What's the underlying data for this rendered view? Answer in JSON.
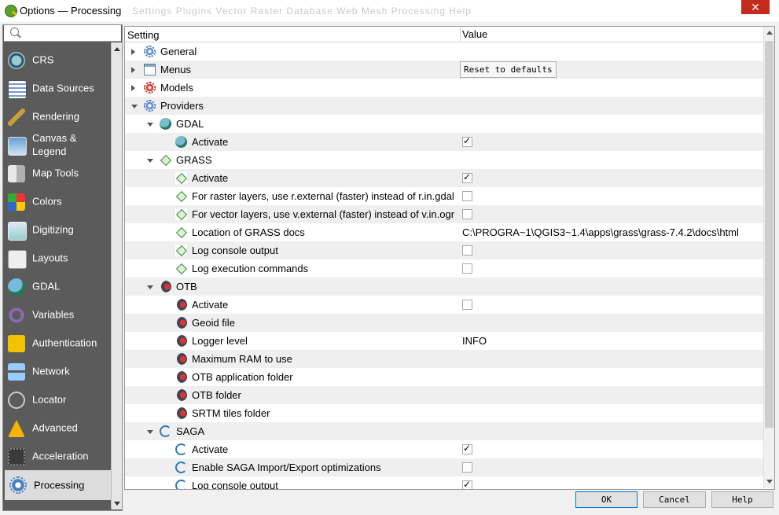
{
  "window": {
    "title": "Options — Processing",
    "background_menu": "Settings   Plugins   Vector   Raster   Database   Web   Mesh   Processing   Help",
    "close_label": "✕"
  },
  "sidebar": {
    "search_placeholder": "",
    "items": [
      {
        "label": "CRS",
        "icon": "globe-grid-icon"
      },
      {
        "label": "Data Sources",
        "icon": "table-icon"
      },
      {
        "label": "Rendering",
        "icon": "paintbrush-icon"
      },
      {
        "label": "Canvas &\nLegend",
        "icon": "map-canvas-icon"
      },
      {
        "label": "Map Tools",
        "icon": "map-tools-icon"
      },
      {
        "label": "Colors",
        "icon": "color-grid-icon"
      },
      {
        "label": "Digitizing",
        "icon": "digitizing-icon"
      },
      {
        "label": "Layouts",
        "icon": "layout-icon"
      },
      {
        "label": "GDAL",
        "icon": "gdal-globe-icon"
      },
      {
        "label": "Variables",
        "icon": "variables-icon"
      },
      {
        "label": "Authentication",
        "icon": "padlock-icon"
      },
      {
        "label": "Network",
        "icon": "network-icon"
      },
      {
        "label": "Locator",
        "icon": "magnifier-icon"
      },
      {
        "label": "Advanced",
        "icon": "warning-icon"
      },
      {
        "label": "Acceleration",
        "icon": "chip-icon"
      },
      {
        "label": "Processing",
        "icon": "gear-icon",
        "selected": true
      }
    ]
  },
  "tree": {
    "columns": [
      "Setting",
      "Value"
    ],
    "reset_label": "Reset to defaults",
    "rows": [
      {
        "label": "General",
        "level": 0,
        "expand": "closed",
        "icon": "gear"
      },
      {
        "label": "Menus",
        "level": 0,
        "expand": "closed",
        "icon": "menu",
        "button": true
      },
      {
        "label": "Models",
        "level": 0,
        "expand": "closed",
        "icon": "gear-red"
      },
      {
        "label": "Providers",
        "level": 0,
        "expand": "open",
        "icon": "gear"
      },
      {
        "label": "GDAL",
        "level": 1,
        "expand": "open",
        "icon": "gdal"
      },
      {
        "label": "Activate",
        "level": 2,
        "icon": "gdal",
        "check": true
      },
      {
        "label": "GRASS",
        "level": 1,
        "expand": "open",
        "icon": "grass"
      },
      {
        "label": "Activate",
        "level": 2,
        "icon": "grass",
        "check": true
      },
      {
        "label": "For raster layers, use r.external (faster) instead of r.in.gdal",
        "level": 2,
        "icon": "grass",
        "check": false
      },
      {
        "label": "For vector layers, use v.external (faster) instead of v.in.ogr",
        "level": 2,
        "icon": "grass",
        "check": false
      },
      {
        "label": "Location of GRASS docs",
        "level": 2,
        "icon": "grass",
        "value": "C:\\PROGRA~1\\QGIS3~1.4\\apps\\grass\\grass-7.4.2\\docs\\html"
      },
      {
        "label": "Log console output",
        "level": 2,
        "icon": "grass",
        "check": false
      },
      {
        "label": "Log execution commands",
        "level": 2,
        "icon": "grass",
        "check": false
      },
      {
        "label": "OTB",
        "level": 1,
        "expand": "open",
        "icon": "otb"
      },
      {
        "label": "Activate",
        "level": 2,
        "icon": "otb",
        "check": false
      },
      {
        "label": "Geoid file",
        "level": 2,
        "icon": "otb"
      },
      {
        "label": "Logger level",
        "level": 2,
        "icon": "otb",
        "value": "INFO"
      },
      {
        "label": "Maximum RAM to use",
        "level": 2,
        "icon": "otb"
      },
      {
        "label": "OTB application folder",
        "level": 2,
        "icon": "otb"
      },
      {
        "label": "OTB folder",
        "level": 2,
        "icon": "otb"
      },
      {
        "label": "SRTM tiles folder",
        "level": 2,
        "icon": "otb"
      },
      {
        "label": "SAGA",
        "level": 1,
        "expand": "open",
        "icon": "saga"
      },
      {
        "label": "Activate",
        "level": 2,
        "icon": "saga",
        "check": true
      },
      {
        "label": "Enable SAGA Import/Export optimizations",
        "level": 2,
        "icon": "saga",
        "check": false
      },
      {
        "label": "Log console output",
        "level": 2,
        "icon": "saga",
        "check": true
      }
    ]
  },
  "buttons": {
    "ok": "OK",
    "cancel": "Cancel",
    "help": "Help"
  }
}
